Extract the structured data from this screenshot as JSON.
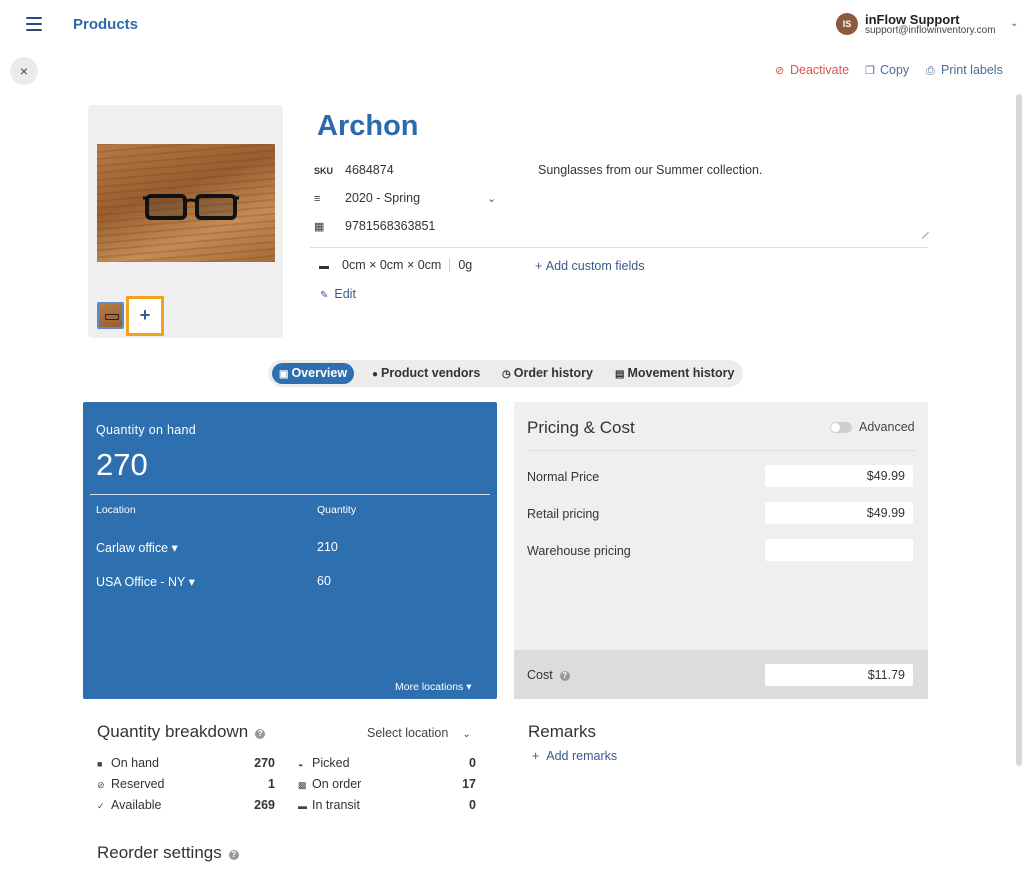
{
  "header": {
    "title": "Products",
    "user_initials": "IS",
    "user_name": "inFlow Support",
    "user_email": "support@inflowinventory.com"
  },
  "actions": {
    "close": "×",
    "deactivate": "Deactivate",
    "copy": "Copy",
    "print_labels": "Print labels"
  },
  "product": {
    "name": "Archon",
    "sku_label": "SKU",
    "sku": "4684874",
    "category": "2020 - Spring",
    "barcode": "9781568363851",
    "description": "Sunglasses from our Summer collection.",
    "dimensions": "0cm × 0cm × 0cm",
    "weight": "0g",
    "add_custom_fields": "Add custom fields",
    "edit": "Edit",
    "add_image": "+"
  },
  "tabs": [
    {
      "label": "Overview",
      "icon": "list-icon",
      "active": true
    },
    {
      "label": "Product vendors",
      "icon": "person-icon"
    },
    {
      "label": "Order history",
      "icon": "clock-icon"
    },
    {
      "label": "Movement history",
      "icon": "box-icon"
    }
  ],
  "quantity": {
    "title": "Quantity on hand",
    "total": "270",
    "col_location": "Location",
    "col_quantity": "Quantity",
    "locations": [
      {
        "name": "Carlaw office ▾",
        "qty": "210"
      },
      {
        "name": "USA Office - NY ▾",
        "qty": "60"
      }
    ],
    "more_locations": "More locations ▾"
  },
  "pricing": {
    "title": "Pricing & Cost",
    "advanced_label": "Advanced",
    "advanced_on": false,
    "rows": [
      {
        "label": "Normal Price",
        "value": "$49.99"
      },
      {
        "label": "Retail pricing",
        "value": "$49.99"
      },
      {
        "label": "Warehouse pricing",
        "value": ""
      }
    ],
    "cost_label": "Cost",
    "cost_value": "$11.79"
  },
  "breakdown": {
    "title": "Quantity breakdown",
    "select_location": "Select location",
    "left": [
      {
        "label": "On hand",
        "value": "270",
        "icon": "square-icon"
      },
      {
        "label": "Reserved",
        "value": "1",
        "icon": "reserved-icon"
      },
      {
        "label": "Available",
        "value": "269",
        "icon": "check-icon"
      }
    ],
    "right": [
      {
        "label": "Picked",
        "value": "0",
        "icon": "picked-icon"
      },
      {
        "label": "On order",
        "value": "17",
        "icon": "lock-icon"
      },
      {
        "label": "In transit",
        "value": "0",
        "icon": "truck-icon"
      }
    ]
  },
  "remarks": {
    "title": "Remarks",
    "add": "Add remarks"
  },
  "reorder": {
    "title": "Reorder settings"
  },
  "colors": {
    "brand_blue": "#2e6faf",
    "title_blue": "#2d6aad",
    "danger": "#d9534f",
    "highlight": "#f0a31f"
  }
}
